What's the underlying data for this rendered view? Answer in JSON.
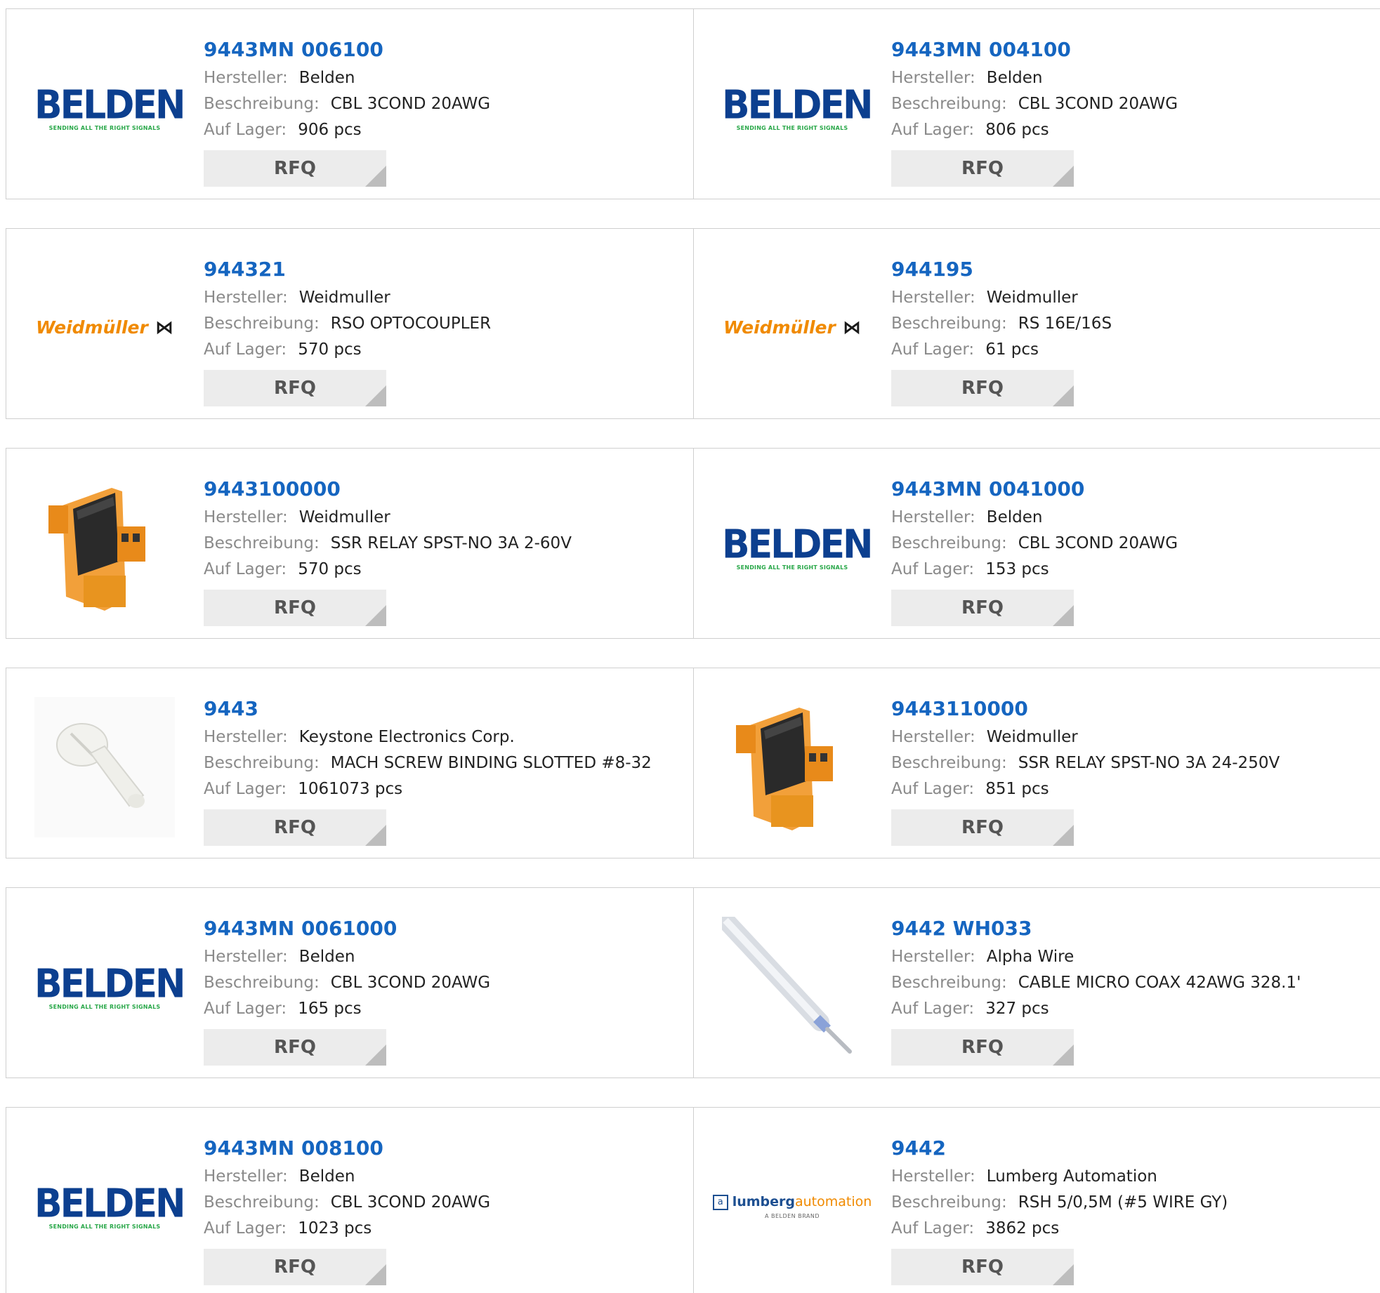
{
  "labels": {
    "manufacturer": "Hersteller:",
    "description": "Beschreibung:",
    "stock": "Auf Lager:",
    "rfq": "RFQ"
  },
  "logos": {
    "belden": {
      "word": "BELDEN",
      "tagline": "SENDING ALL THE RIGHT SIGNALS"
    },
    "weidmuller": {
      "word": "Weidmüller"
    },
    "lumberg": {
      "part1": "lumberg",
      "part2": "automation",
      "sub": "A BELDEN BRAND"
    }
  },
  "colors": {
    "part_link": "#1565c0",
    "label_gray": "#8a8a8a",
    "rfq_bg": "#ececec",
    "belden_blue": "#0c3f8f",
    "belden_green": "#2aa84a",
    "weidmuller_orange": "#f08a00"
  },
  "products": [
    {
      "part_number": "9443MN 006100",
      "manufacturer": "Belden",
      "description": "CBL 3COND 20AWG",
      "stock": "906 pcs",
      "image": "belden-logo"
    },
    {
      "part_number": "9443MN 004100",
      "manufacturer": "Belden",
      "description": "CBL 3COND 20AWG",
      "stock": "806 pcs",
      "image": "belden-logo"
    },
    {
      "part_number": "944321",
      "manufacturer": "Weidmuller",
      "description": "RSO OPTOCOUPLER",
      "stock": "570 pcs",
      "image": "weidmuller-logo"
    },
    {
      "part_number": "944195",
      "manufacturer": "Weidmuller",
      "description": "RS 16E/16S",
      "stock": "61 pcs",
      "image": "weidmuller-logo"
    },
    {
      "part_number": "9443100000",
      "manufacturer": "Weidmuller",
      "description": "SSR RELAY SPST-NO 3A 2-60V",
      "stock": "570 pcs",
      "image": "relay-photo"
    },
    {
      "part_number": "9443MN 0041000",
      "manufacturer": "Belden",
      "description": "CBL 3COND 20AWG",
      "stock": "153 pcs",
      "image": "belden-logo"
    },
    {
      "part_number": "9443",
      "manufacturer": "Keystone Electronics Corp.",
      "description": "MACH SCREW BINDING SLOTTED #8-32",
      "stock": "1061073 pcs",
      "image": "screw-photo"
    },
    {
      "part_number": "9443110000",
      "manufacturer": "Weidmuller",
      "description": "SSR RELAY SPST-NO 3A 24-250V",
      "stock": "851 pcs",
      "image": "relay-photo"
    },
    {
      "part_number": "9443MN 0061000",
      "manufacturer": "Belden",
      "description": "CBL 3COND 20AWG",
      "stock": "165 pcs",
      "image": "belden-logo"
    },
    {
      "part_number": "9442 WH033",
      "manufacturer": "Alpha Wire",
      "description": "CABLE MICRO COAX 42AWG 328.1'",
      "stock": "327 pcs",
      "image": "coax-cable-photo"
    },
    {
      "part_number": "9443MN 008100",
      "manufacturer": "Belden",
      "description": "CBL 3COND 20AWG",
      "stock": "1023 pcs",
      "image": "belden-logo"
    },
    {
      "part_number": "9442",
      "manufacturer": "Lumberg Automation",
      "description": "RSH 5/0,5M (#5 WIRE GY)",
      "stock": "3862 pcs",
      "image": "lumberg-logo"
    }
  ]
}
